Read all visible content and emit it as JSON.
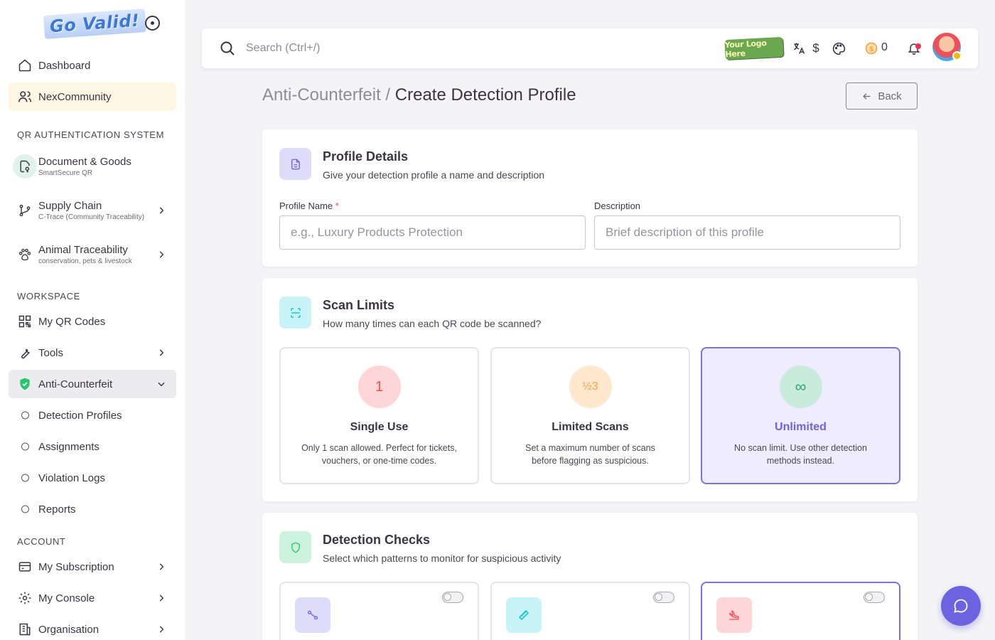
{
  "brand": {
    "logo_text": "Go Valid!"
  },
  "sidebar": {
    "dashboard": "Dashboard",
    "community": "NexCommunity",
    "section_qr": "QR AUTHENTICATION SYSTEM",
    "doc_goods": {
      "label": "Document & Goods",
      "sub": "SmartSecure QR"
    },
    "supply_chain": {
      "label": "Supply Chain",
      "sub": "C-Trace (Community Traceability)"
    },
    "animal": {
      "label": "Animal Traceability",
      "sub": "conservation, pets & livestock"
    },
    "section_workspace": "WORKSPACE",
    "my_qr": "My QR Codes",
    "tools": "Tools",
    "anti_counterfeit": "Anti-Counterfeit",
    "sub_items": [
      "Detection Profiles",
      "Assignments",
      "Violation Logs",
      "Reports"
    ],
    "section_account": "ACCOUNT",
    "subscription": "My Subscription",
    "console": "My Console",
    "organisation": "Organisation"
  },
  "topbar": {
    "search_placeholder": "Search (Ctrl+/)",
    "logo_placeholder": "Your Logo Here",
    "currency": "$",
    "coin_count": "0"
  },
  "page": {
    "breadcrumb": "Anti-Counterfeit /",
    "title": "Create Detection Profile",
    "back_label": "Back"
  },
  "profile_details": {
    "title": "Profile Details",
    "subtitle": "Give your detection profile a name and description",
    "name_label": "Profile Name",
    "required_mark": "*",
    "name_placeholder": "e.g., Luxury Products Protection",
    "desc_label": "Description",
    "desc_placeholder": "Brief description of this profile"
  },
  "scan_limits": {
    "title": "Scan Limits",
    "subtitle": "How many times can each QR code be scanned?",
    "options": [
      {
        "symbol": "1",
        "title": "Single Use",
        "desc": "Only 1 scan allowed. Perfect for tickets, vouchers, or one-time codes.",
        "color": "#ffd6d7",
        "fg": "#ff4c51"
      },
      {
        "symbol": "½3",
        "title": "Limited Scans",
        "desc": "Set a maximum number of scans before flagging as suspicious.",
        "color": "#ffe8cc",
        "fg": "#ff9f43"
      },
      {
        "symbol": "∞",
        "title": "Unlimited",
        "desc": "No scan limit. Use other detection methods instead.",
        "color": "#c9ebdc",
        "fg": "#28a96b"
      }
    ],
    "selected": "Unlimited"
  },
  "detection_checks": {
    "title": "Detection Checks",
    "subtitle": "Select which patterns to monitor for suspicious activity"
  },
  "colors": {
    "primary": "#6d62e0",
    "success": "#28c76f",
    "danger": "#ff4c51",
    "warning": "#ff9f43",
    "info": "#00cfe8"
  }
}
